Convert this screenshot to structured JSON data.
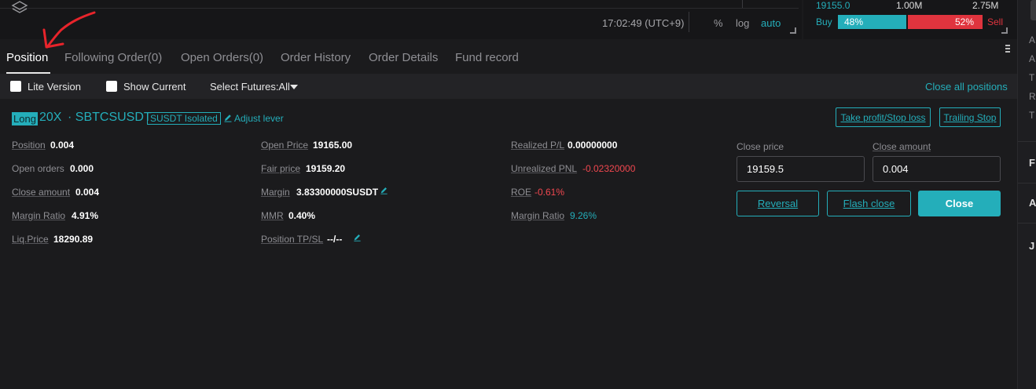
{
  "chart_footer": {
    "time": "17:02:49 (UTC+9)",
    "percent_toggle": "%",
    "log_toggle": "log",
    "auto_toggle": "auto"
  },
  "orderbook": {
    "price": "19155.0",
    "volume_1": "1.00M",
    "volume_2": "2.75M",
    "buy_label": "Buy",
    "buy_percent": "48%",
    "buy_ratio": 0.48,
    "sell_percent": "52%",
    "sell_label": "Sell"
  },
  "right_sidebar": {
    "letters": [
      "A",
      "A",
      "T",
      "R",
      "T"
    ],
    "section_letters": [
      "F",
      "A",
      "J"
    ]
  },
  "tabs": [
    {
      "label": "Position",
      "active": true
    },
    {
      "label": "Following Order(0)",
      "active": false
    },
    {
      "label": "Open Orders(0)",
      "active": false
    },
    {
      "label": "Order History",
      "active": false
    },
    {
      "label": "Order Details",
      "active": false
    },
    {
      "label": "Fund record",
      "active": false
    }
  ],
  "filters": {
    "lite_version": "Lite Version",
    "show_current": "Show Current",
    "select_futures": "Select Futures:All",
    "close_all": "Close all positions"
  },
  "position": {
    "direction": "Long",
    "leverage": "20X",
    "symbol": "· SBTCSUSDT",
    "margin_mode": "SUSDT Isolated",
    "adjust_lever": "Adjust lever",
    "tpsl_button": "Take profit/Stop loss",
    "trailing_button": "Trailing Stop",
    "col1": [
      {
        "label": "Position",
        "value": "0.004"
      },
      {
        "label": "Open orders",
        "value": "0.000"
      },
      {
        "label": "Close amount",
        "value": "0.004"
      },
      {
        "label": "Margin Ratio",
        "value": "4.91%"
      },
      {
        "label": "Liq.Price",
        "value": "18290.89"
      }
    ],
    "col2": [
      {
        "label": "Open Price",
        "value": "19165.00"
      },
      {
        "label": "Fair price",
        "value": "19159.20"
      },
      {
        "label": "Margin",
        "value": "3.83300000SUSDT"
      },
      {
        "label": "MMR",
        "value": "0.40%"
      },
      {
        "label": "Position TP/SL",
        "value": "--/--"
      }
    ],
    "col3": [
      {
        "label": "Realized P/L",
        "value": "0.00000000"
      },
      {
        "label": "Unrealized PNL",
        "value": "-0.02320000"
      },
      {
        "label": "ROE",
        "value": "-0.61%"
      },
      {
        "label": "Margin Ratio",
        "value": "9.26%"
      }
    ],
    "close_price_label": "Close price",
    "close_price_value": "19159.5",
    "close_amount_label": "Close amount",
    "close_amount_value": "0.004",
    "reversal_button": "Reversal",
    "flash_close_button": "Flash close",
    "close_button": "Close"
  },
  "colors": {
    "accent": "#24aeba",
    "sell": "#e0343e",
    "negative": "#f0474f",
    "annotation": "#e8242b"
  }
}
